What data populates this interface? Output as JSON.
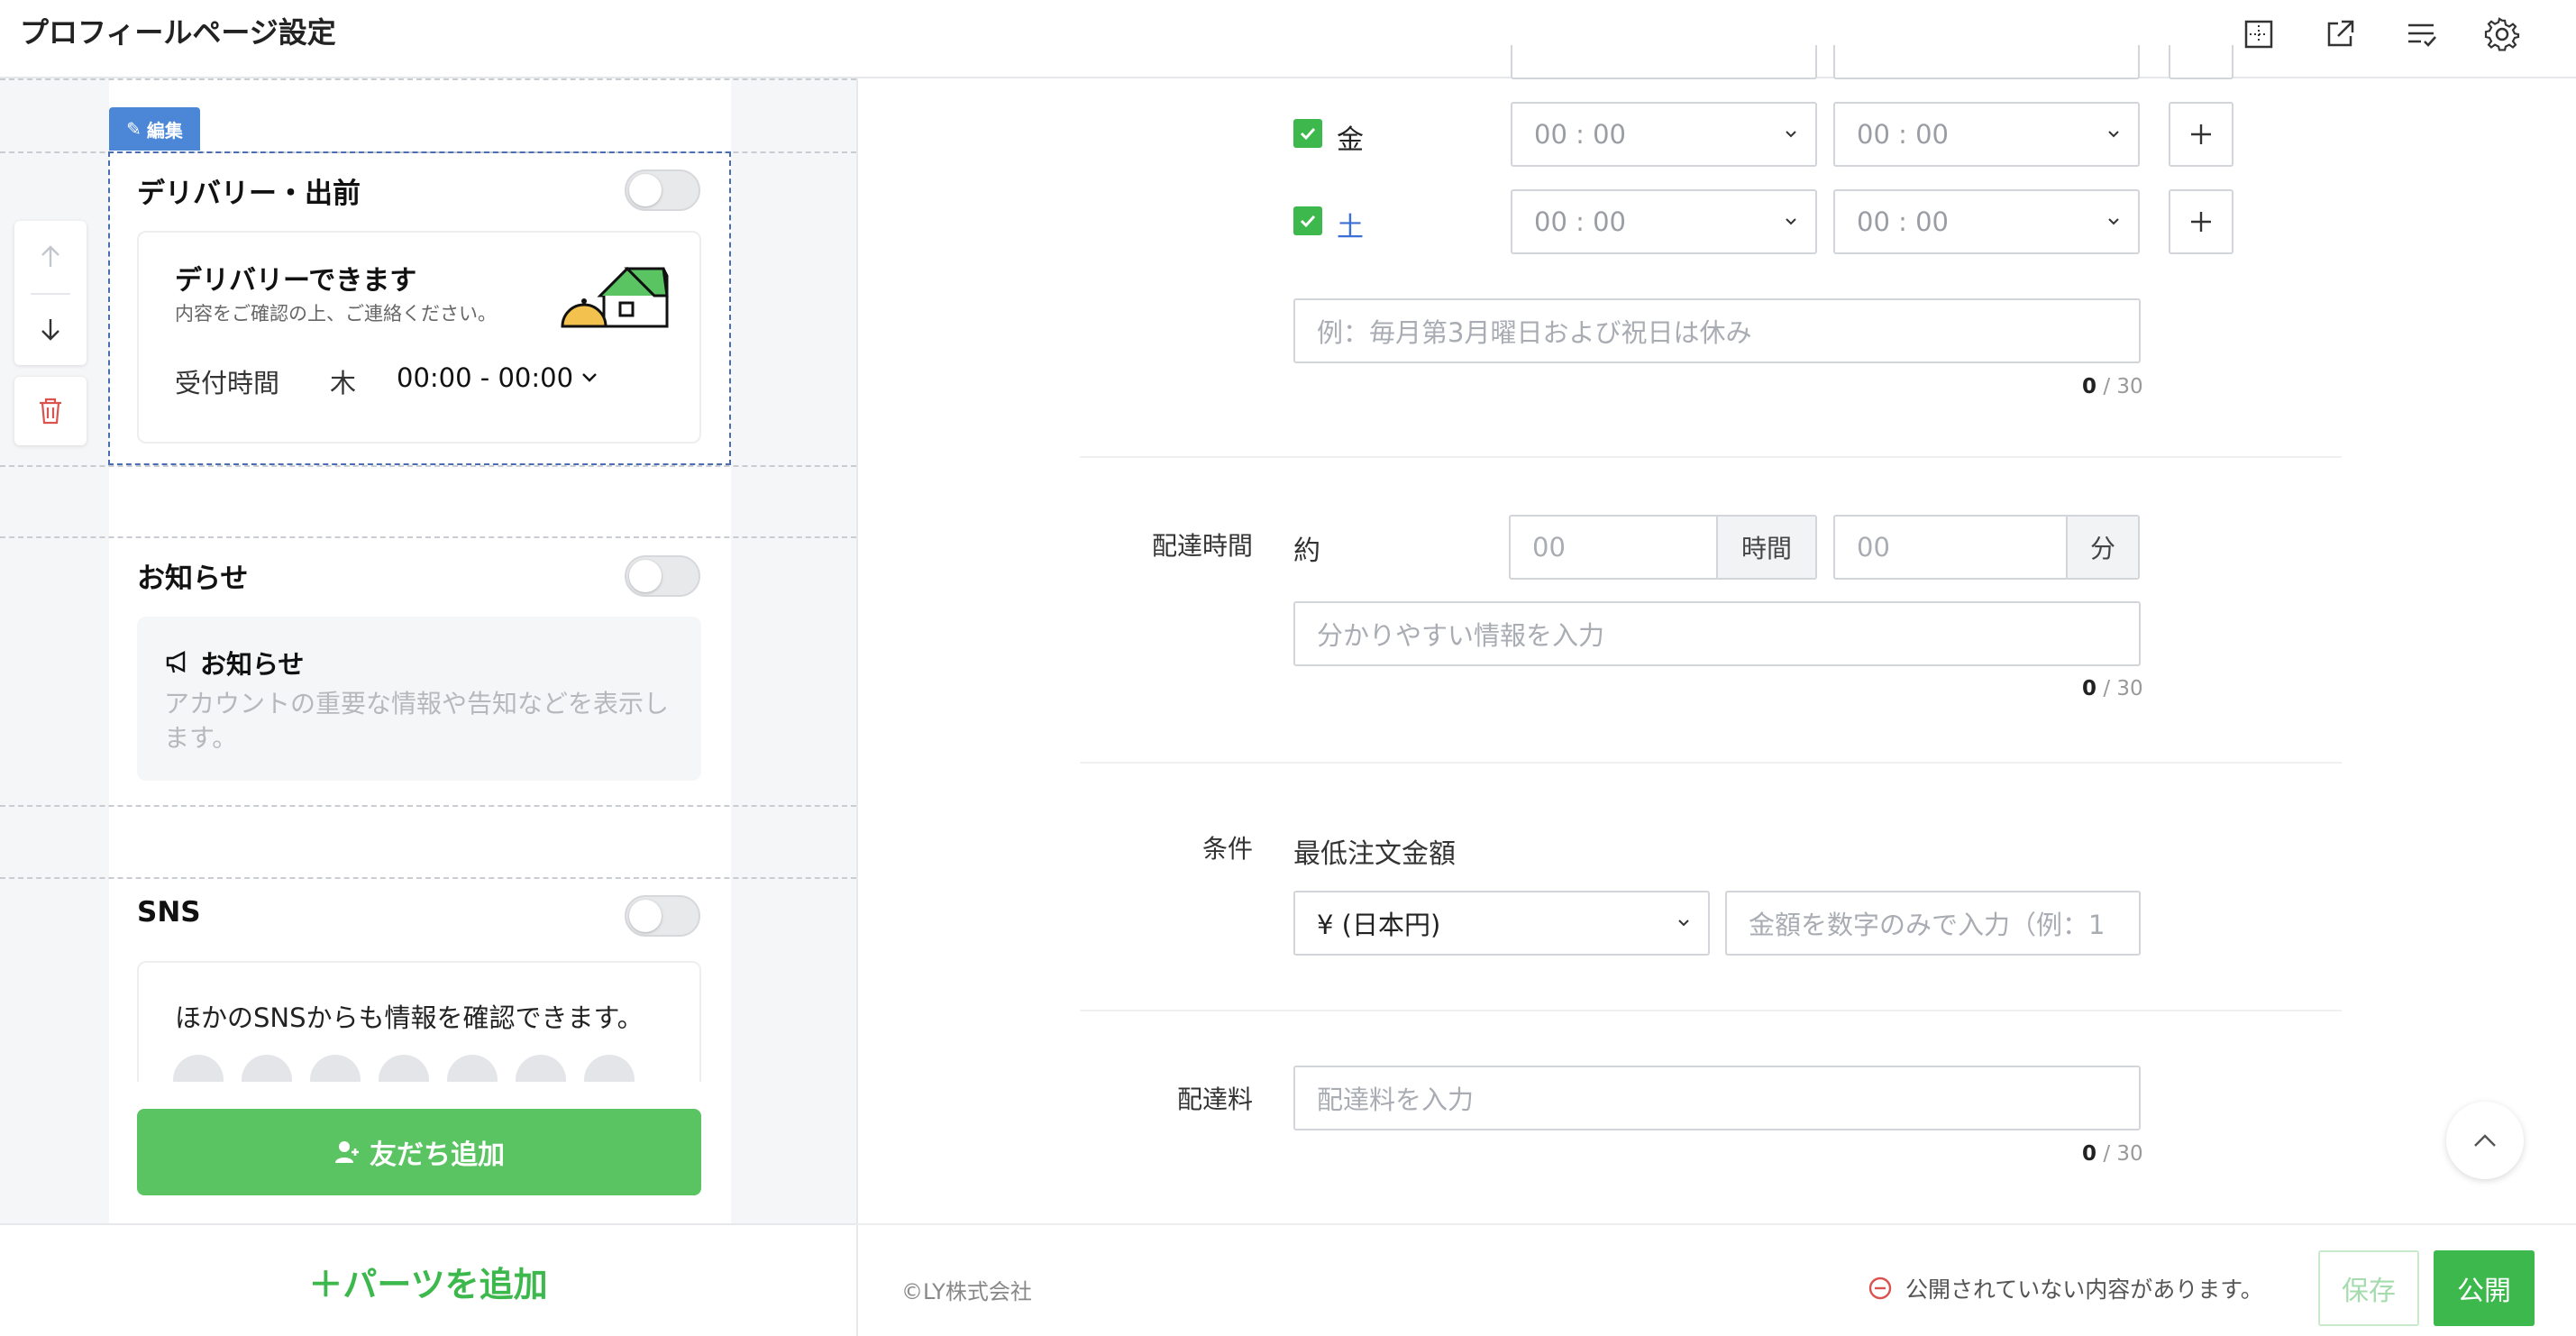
{
  "header": {
    "title": "プロフィールページ設定",
    "icons": [
      "guide-icon",
      "external-link-icon",
      "checklist-icon",
      "settings-icon"
    ]
  },
  "preview": {
    "edit_tag": "編集",
    "delivery": {
      "title": "デリバリー・出前",
      "enabled": false,
      "card_title": "デリバリーできます",
      "card_sub": "内容をご確認の上、ご連絡ください。",
      "hours_label": "受付時間",
      "hours_day": "木",
      "hours_value": "00:00 - 00:00"
    },
    "notice": {
      "title": "お知らせ",
      "enabled": false,
      "card_title": "お知らせ",
      "card_desc": "アカウントの重要な情報や告知などを表示します。"
    },
    "sns": {
      "title": "SNS",
      "enabled": false,
      "card_text": "ほかのSNSからも情報を確認できます。"
    },
    "add_friend": "友だち追加",
    "add_parts": "＋パーツを追加"
  },
  "form": {
    "days": [
      {
        "label": "金",
        "checked": true,
        "start": "00 : 00",
        "end": "00 : 00"
      },
      {
        "label": "土",
        "checked": true,
        "start": "00 : 00",
        "end": "00 : 00",
        "color": "#3c6fd6"
      }
    ],
    "holiday_placeholder": "例：毎月第3月曜日および祝日は休み",
    "holiday_count": "0",
    "holiday_max": "/ 30",
    "delivery_time": {
      "label": "配達時間",
      "prefix": "約",
      "hours_placeholder": "00",
      "hours_unit": "時間",
      "minutes_placeholder": "00",
      "minutes_unit": "分",
      "info_placeholder": "分かりやすい情報を入力",
      "count": "0",
      "max": "/ 30"
    },
    "conditions": {
      "label": "条件",
      "min_order_label": "最低注文金額",
      "currency": "¥ (日本円)",
      "amount_placeholder": "金額を数字のみで入力（例：1"
    },
    "fee": {
      "label": "配達料",
      "placeholder": "配達料を入力",
      "count": "0",
      "max": "/ 30"
    }
  },
  "footer": {
    "copyright": "©LY株式会社",
    "unpublished_msg": "公開されていない内容があります。",
    "save": "保存",
    "publish": "公開"
  },
  "colors": {
    "accent_green": "#3db84c",
    "edit_blue": "#4b87d6",
    "saturday_blue": "#3c6fd6"
  }
}
